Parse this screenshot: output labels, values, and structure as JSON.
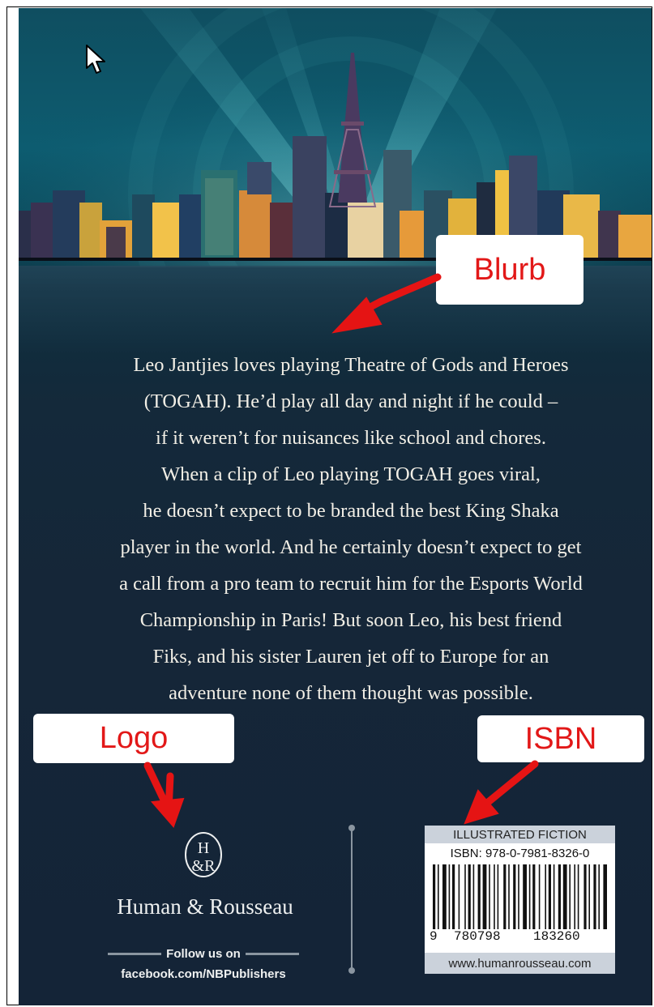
{
  "blurb": {
    "lines": [
      "Leo Jantjies loves playing Theatre of Gods and Heroes",
      "(TOGAH). He’d play all day and night if he could –",
      "if it weren’t for nuisances like school and chores.",
      "When a clip of Leo playing TOGAH goes viral,",
      "he doesn’t expect to be branded the best King Shaka",
      "player in the world. And he certainly doesn’t expect to get",
      "a call from a pro team to recruit him for the Esports World",
      "Championship in Paris! But soon Leo, his best friend",
      "Fiks, and his sister Lauren jet off to Europe for an",
      "adventure none of them thought was possible."
    ]
  },
  "callouts": {
    "blurb": "Blurb",
    "logo": "Logo",
    "isbn": "ISBN"
  },
  "publisher": {
    "name": "Human & Rousseau",
    "follow_label": "Follow us on",
    "facebook": "facebook.com/NBPublishers",
    "logo_monogram": "H&R"
  },
  "isbn_box": {
    "category": "ILLUSTRATED FICTION",
    "isbn": "ISBN: 978-0-7981-8326-0",
    "digits": [
      "9",
      "780798",
      "183260"
    ],
    "website": "www.humanrousseau.com"
  },
  "colors": {
    "callout_text": "#e21818",
    "cover_bg": "#152638",
    "sky_teal": "#0d5c70"
  }
}
